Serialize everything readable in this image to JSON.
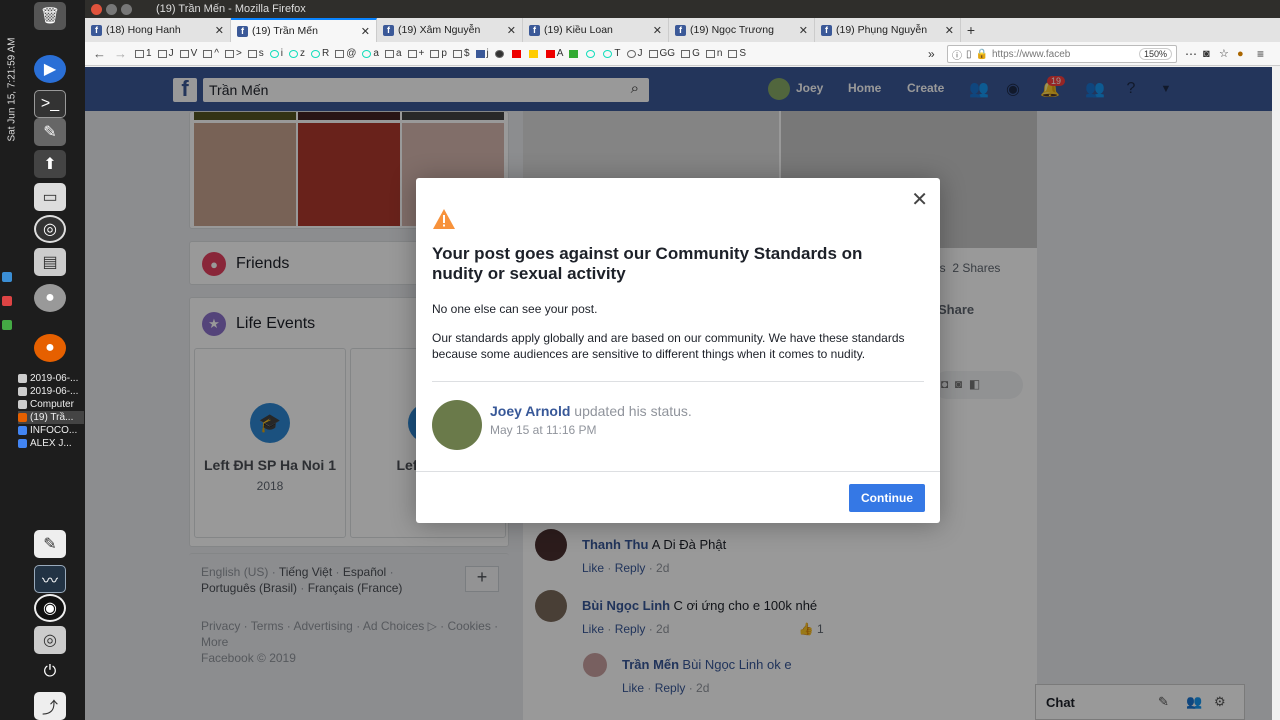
{
  "dock": {
    "clock": "Sat Jun 15,  7:21:59 AM",
    "windows": [
      "2019-06-...",
      "2019-06-...",
      "Computer",
      "(19) Trầ...",
      "INFOCO...",
      "ALEX J..."
    ]
  },
  "window": {
    "title": "(19) Trần Mến - Mozilla Firefox"
  },
  "tabs": [
    {
      "label": "(18) Hong Hanh",
      "active": false
    },
    {
      "label": "(19) Trần Mến",
      "active": true
    },
    {
      "label": "(19) Xâm Nguyễn",
      "active": false
    },
    {
      "label": "(19) Kiều Loan",
      "active": false
    },
    {
      "label": "(19) Ngọc Trương",
      "active": false
    },
    {
      "label": "(19) Phụng Nguyễn",
      "active": false
    }
  ],
  "toolbar": {
    "bookmarks": [
      "1",
      "J",
      "V",
      "^",
      ">",
      "s",
      "i",
      "z",
      "R",
      "@",
      "a",
      "a",
      "+",
      "p",
      "$",
      "j",
      "A",
      "T",
      "J",
      "GG",
      "G",
      "n",
      "S"
    ],
    "url": "https://www.faceb",
    "zoom": "150%"
  },
  "facebook": {
    "search_value": "Trần Mến",
    "nav_user": "Joey",
    "nav_home": "Home",
    "nav_create": "Create",
    "notif_count": "19"
  },
  "left": {
    "friends_title": "Friends",
    "life_title": "Life Events",
    "life_events": [
      {
        "title": "Left ĐH SP Ha Noi 1",
        "year": "2018"
      },
      {
        "title": "Left ĐH S",
        "year": "2"
      }
    ],
    "languages": [
      "English (US)",
      "Tiếng Việt",
      "Español",
      "Português (Brasil)",
      "Français (France)"
    ],
    "footer_links": [
      "Privacy",
      "Terms",
      "Advertising",
      "Ad Choices",
      "Cookies",
      "More"
    ],
    "copyright": "Facebook © 2019"
  },
  "right": {
    "shares_partial": "ents",
    "shares": "2 Shares",
    "share_btn": "Share",
    "comments": [
      {
        "name": "Thanh Thu",
        "text": "A Di Đà Phật",
        "like": "Like",
        "reply": "Reply",
        "time": "2d"
      },
      {
        "name": "Bùi Ngọc Linh",
        "text": "C ơi ứng cho e 100k nhé",
        "like": "Like",
        "reply": "Reply",
        "time": "2d",
        "reactions": "1"
      },
      {
        "name": "Trần Mến",
        "text": "Bùi Ngọc Linh ok e",
        "like": "Like",
        "reply": "Reply",
        "time": "2d"
      }
    ],
    "chat": "Chat"
  },
  "modal": {
    "title": "Your post goes against our Community Standards on nudity or sexual activity",
    "line1": "No one else can see your post.",
    "line2": "Our standards apply globally and are based on our community. We have these standards because some audiences are sensitive to different things when it comes to nudity.",
    "post_author": "Joey Arnold",
    "post_action": "updated his status.",
    "post_date": "May 15 at 11:16 PM",
    "continue_label": "Continue"
  }
}
